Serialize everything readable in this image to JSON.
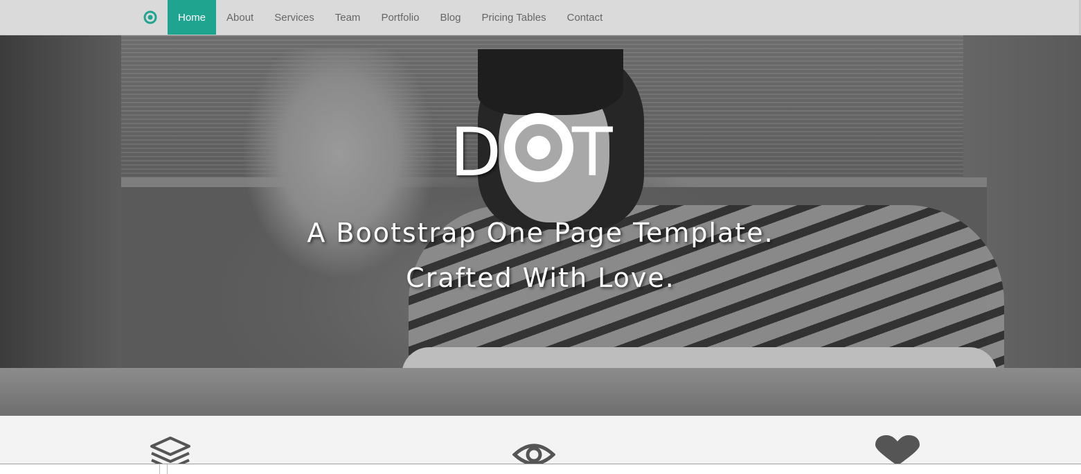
{
  "navbar": {
    "brand_icon": "target-dot-icon",
    "accent_color": "#1fa58f",
    "items": [
      {
        "label": "Home",
        "active": true
      },
      {
        "label": "About"
      },
      {
        "label": "Services"
      },
      {
        "label": "Team"
      },
      {
        "label": "Portfolio"
      },
      {
        "label": "Blog"
      },
      {
        "label": "Pricing Tables"
      },
      {
        "label": "Contact"
      }
    ]
  },
  "hero": {
    "logo_text": "DOT",
    "tagline_line1": "A Bootstrap One Page Template.",
    "tagline_line2": "Crafted With Love."
  },
  "features": {
    "icons": [
      "layers-icon",
      "eye-icon",
      "heart-icon"
    ]
  }
}
